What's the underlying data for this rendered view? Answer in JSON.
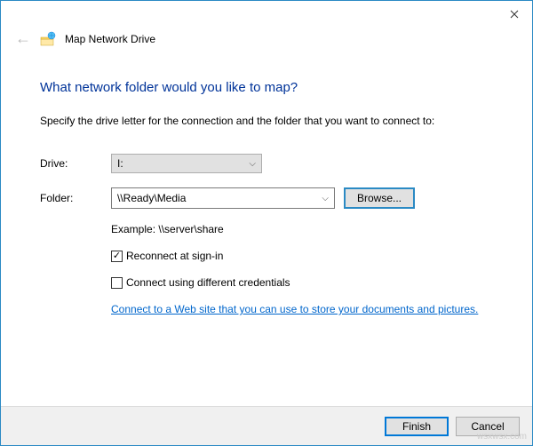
{
  "header": {
    "title": "Map Network Drive"
  },
  "content": {
    "heading": "What network folder would you like to map?",
    "instruction": "Specify the drive letter for the connection and the folder that you want to connect to:",
    "driveLabel": "Drive:",
    "driveValue": "I:",
    "folderLabel": "Folder:",
    "folderValue": "\\\\Ready\\Media",
    "browseLabel": "Browse...",
    "exampleText": "Example: \\\\server\\share",
    "reconnectLabel": "Reconnect at sign-in",
    "credentialsLabel": "Connect using different credentials",
    "linkText": "Connect to a Web site that you can use to store your documents and pictures."
  },
  "footer": {
    "finishLabel": "Finish",
    "cancelLabel": "Cancel"
  },
  "watermark": "wsxwsx.com"
}
